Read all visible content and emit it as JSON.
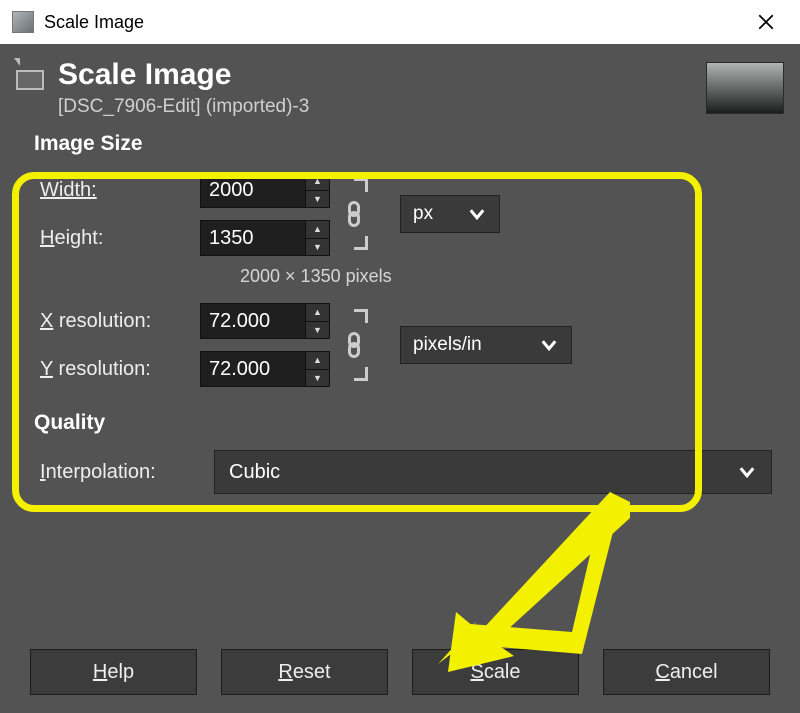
{
  "window": {
    "title": "Scale Image"
  },
  "header": {
    "title": "Scale Image",
    "subtitle": "[DSC_7906-Edit] (imported)-3"
  },
  "image_size": {
    "section_title": "Image Size",
    "width_label": "Width:",
    "height_label": "Height:",
    "width_value": "2000",
    "height_value": "1350",
    "dims_text": "2000 × 1350 pixels",
    "size_unit": "px",
    "xres_label": "X resolution:",
    "yres_label": "Y resolution:",
    "xres_value": "72.000",
    "yres_value": "72.000",
    "res_unit": "pixels/in"
  },
  "quality": {
    "section_title": "Quality",
    "interpolation_label": "Interpolation:",
    "interpolation_value": "Cubic"
  },
  "buttons": {
    "help": "Help",
    "reset": "Reset",
    "scale": "Scale",
    "cancel": "Cancel"
  }
}
